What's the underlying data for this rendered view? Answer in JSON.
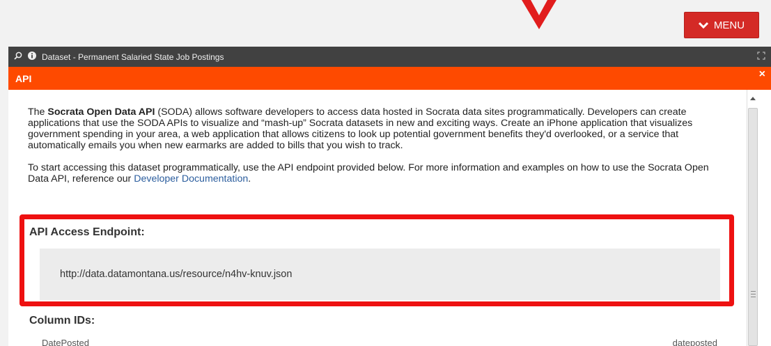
{
  "header": {
    "menu_label": "MENU"
  },
  "dataset_bar": {
    "title": "Dataset - Permanent Salaried State Job Postings"
  },
  "api_panel": {
    "title": "API",
    "close_label": "×",
    "intro": {
      "p1_prefix": "The ",
      "p1_bold": "Socrata Open Data API",
      "p1_rest": " (SODA) allows software developers to access data hosted in Socrata data sites programmatically. Developers can create applications that use the SODA APIs to visualize and “mash-up” Socrata datasets in new and exciting ways. Create an iPhone application that visualizes government spending in your area, a web application that allows citizens to look up potential government benefits they'd overlooked, or a service that automatically emails you when new earmarks are added to bills that you wish to track.",
      "p2_text": "To start accessing this dataset programmatically, use the API endpoint provided below. For more information and examples on how to use the Socrata Open Data API, reference our ",
      "p2_link": "Developer Documentation",
      "p2_end": "."
    },
    "endpoint_label": "API Access Endpoint:",
    "endpoint_url": "http://data.datamontana.us/resource/n4hv-knuv.json",
    "column_ids_label": "Column IDs:",
    "columns": [
      {
        "name": "DatePosted",
        "id": "dateposted"
      }
    ]
  },
  "colors": {
    "orange_header": "#fe4a00",
    "menu_button": "#d42a26",
    "highlight": "#ee1111",
    "dark_bar": "#414141",
    "link": "#2c5e9e"
  }
}
